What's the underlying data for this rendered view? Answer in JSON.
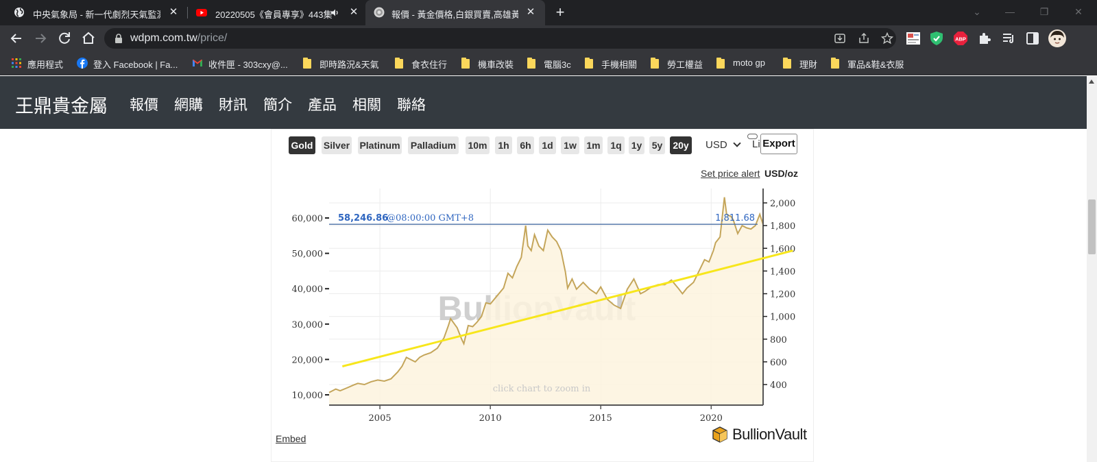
{
  "browser": {
    "tabs": [
      {
        "title": "中央氣象局 - 新一代劇烈天氣監測",
        "active": false
      },
      {
        "title": "20220505《會員專享》443集",
        "active": false
      },
      {
        "title": "報價 - 黃金價格,白銀買賣,高雄黃金",
        "active": true
      }
    ],
    "new_tab": "+",
    "url_host": "wdpm.com.tw",
    "url_path": "/price/",
    "bookmarks": [
      {
        "label": "應用程式",
        "icon": "apps-grid-icon"
      },
      {
        "label": "登入 Facebook | Fa...",
        "icon": "facebook-icon"
      },
      {
        "label": "收件匣 - 303cxy@...",
        "icon": "gmail-icon"
      },
      {
        "label": "即時路況&天氣",
        "icon": "folder-icon"
      },
      {
        "label": "食衣住行",
        "icon": "folder-icon"
      },
      {
        "label": "機車改裝",
        "icon": "folder-icon"
      },
      {
        "label": "電腦3c",
        "icon": "folder-icon"
      },
      {
        "label": "手機相關",
        "icon": "folder-icon"
      },
      {
        "label": "勞工權益",
        "icon": "folder-icon"
      },
      {
        "label": "moto gp",
        "icon": "folder-icon"
      },
      {
        "label": "理財",
        "icon": "folder-icon"
      },
      {
        "label": "軍品&鞋&衣服",
        "icon": "folder-icon"
      }
    ]
  },
  "site": {
    "logo": "王鼎貴金屬",
    "nav": [
      "報價",
      "網購",
      "財訊",
      "簡介",
      "產品",
      "相關",
      "聯絡"
    ]
  },
  "widget": {
    "metals": [
      "Gold",
      "Silver",
      "Platinum",
      "Palladium"
    ],
    "active_metal": "Gold",
    "ranges": [
      "10m",
      "1h",
      "6h",
      "1d",
      "1w",
      "1m",
      "1q",
      "1y",
      "5y",
      "20y"
    ],
    "active_range": "20y",
    "currency": "USD",
    "li_label": "Li",
    "export": "Export",
    "price_alert": "Set price alert",
    "unit": "USD/oz",
    "embed": "Embed",
    "brand": "BullionVault",
    "watermark": "BullionVault",
    "zoom_hint": "click chart to zoom in"
  },
  "chart_data": {
    "type": "area",
    "xticks": [
      "2005",
      "2010",
      "2015",
      "2020"
    ],
    "xlim": [
      2002.7,
      2022.35
    ],
    "y_left_ticks": [
      "60,000",
      "50,000",
      "40,000",
      "30,000",
      "20,000",
      "10,000"
    ],
    "y_left_tick_values": [
      60000,
      50000,
      40000,
      30000,
      20000,
      10000
    ],
    "y_right_ticks": [
      "2,000",
      "1,800",
      "1,600",
      "1,400",
      "1,200",
      "1,000",
      "800",
      "600",
      "400"
    ],
    "y_right_tick_values": [
      2000,
      1800,
      1600,
      1400,
      1200,
      1000,
      800,
      600,
      400
    ],
    "ylim_usd": [
      230,
      2050
    ],
    "current_left_label": "58,246.86",
    "current_time": "@08:00:00 GMT+8",
    "current_right_label": "1,811.68",
    "current_value_usd": 1811.68,
    "colors": {
      "line": "#c4a55a",
      "fill": "#fdf3de",
      "price_line": "#4a6fa5",
      "price_text": "#2f66c0",
      "trend": "#f7e61c"
    },
    "series": [
      {
        "x": [
          2002.7,
          2003.0,
          2003.2,
          2003.5,
          2003.8,
          2004.0,
          2004.3,
          2004.6,
          2004.9,
          2005.2,
          2005.5,
          2005.8,
          2006.0,
          2006.2,
          2006.4,
          2006.6,
          2006.8,
          2007.0,
          2007.3,
          2007.6,
          2007.9,
          2008.1,
          2008.2,
          2008.5,
          2008.7,
          2008.8,
          2009.0,
          2009.2,
          2009.4,
          2009.6,
          2009.8,
          2010.0,
          2010.3,
          2010.6,
          2010.8,
          2011.0,
          2011.2,
          2011.4,
          2011.6,
          2011.7,
          2011.85,
          2012.0,
          2012.2,
          2012.4,
          2012.6,
          2012.8,
          2013.0,
          2013.2,
          2013.4,
          2013.5,
          2013.7,
          2013.9,
          2014.2,
          2014.5,
          2014.8,
          2015.0,
          2015.3,
          2015.6,
          2015.9,
          2016.2,
          2016.5,
          2016.8,
          2017.0,
          2017.3,
          2017.6,
          2017.9,
          2018.2,
          2018.5,
          2018.7,
          2018.9,
          2019.2,
          2019.5,
          2019.7,
          2019.9,
          2020.1,
          2020.2,
          2020.4,
          2020.6,
          2020.7,
          2020.9,
          2021.0,
          2021.2,
          2021.4,
          2021.6,
          2021.8,
          2022.0,
          2022.2,
          2022.35
        ],
        "y": [
          330,
          360,
          345,
          370,
          395,
          410,
          400,
          425,
          440,
          430,
          450,
          510,
          560,
          640,
          620,
          600,
          640,
          660,
          680,
          720,
          810,
          920,
          980,
          900,
          800,
          760,
          920,
          910,
          950,
          1000,
          1120,
          1110,
          1180,
          1250,
          1380,
          1340,
          1440,
          1520,
          1800,
          1620,
          1580,
          1720,
          1620,
          1580,
          1760,
          1700,
          1660,
          1580,
          1390,
          1250,
          1330,
          1240,
          1300,
          1240,
          1200,
          1260,
          1150,
          1100,
          1070,
          1240,
          1330,
          1200,
          1220,
          1260,
          1280,
          1280,
          1320,
          1250,
          1200,
          1250,
          1300,
          1420,
          1500,
          1480,
          1580,
          1650,
          1700,
          2050,
          1900,
          1880,
          1850,
          1730,
          1800,
          1780,
          1770,
          1800,
          1900,
          1810
        ]
      }
    ],
    "trendline": {
      "x": [
        2003.3,
        2023.7
      ],
      "usd": [
        560,
        1580
      ]
    }
  }
}
